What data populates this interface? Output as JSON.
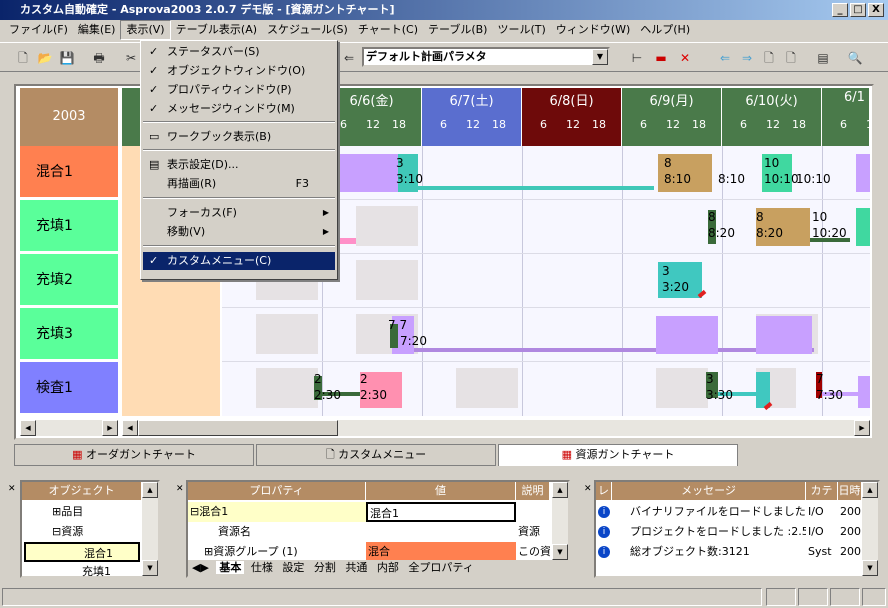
{
  "window": {
    "title": "カスタム自動確定 - Asprova2003 2.0.7 デモ版 - [資源ガントチャート]",
    "min": "_",
    "max": "□",
    "close": "X"
  },
  "menu": [
    "ファイル(F)",
    "編集(E)",
    "表示(V)",
    "テーブル表示(A)",
    "スケジュール(S)",
    "チャート(C)",
    "テーブル(B)",
    "ツール(T)",
    "ウィンドウ(W)",
    "ヘルプ(H)"
  ],
  "toolbar": {
    "param_combo": "デフォルト計画パラメタ"
  },
  "view_menu": {
    "items": [
      {
        "label": "ステータスバー(S)",
        "checked": "✓"
      },
      {
        "label": "オブジェクトウィンドウ(O)",
        "checked": "✓"
      },
      {
        "label": "プロパティウィンドウ(P)",
        "checked": "✓"
      },
      {
        "label": "メッセージウィンドウ(M)",
        "checked": "✓"
      },
      {
        "label": "ワークブック表示(B)"
      },
      {
        "label": "表示設定(D)..."
      },
      {
        "label": "再描画(R)",
        "shortcut": "F3"
      },
      {
        "label": "フォーカス(F)",
        "submenu": "▶"
      },
      {
        "label": "移動(V)",
        "submenu": "▶"
      },
      {
        "label": "カスタムメニュー(C)",
        "checked": "✓"
      }
    ]
  },
  "gantt": {
    "year": "2003",
    "days": [
      {
        "label": "6/6(金)",
        "color": "#4a7a4a"
      },
      {
        "label": "6/7(土)",
        "color": "#5a6ecf"
      },
      {
        "label": "6/8(日)",
        "color": "#6e0a0a"
      },
      {
        "label": "6/9(月)",
        "color": "#4a7a4a"
      },
      {
        "label": "6/10(火)",
        "color": "#4a7a4a"
      },
      {
        "label": "6/1",
        "color": "#4a7a4a"
      }
    ],
    "ticks": [
      "6",
      "12",
      "18"
    ],
    "resources": [
      {
        "name": "混合1",
        "color": "#ff8050"
      },
      {
        "name": "充填1",
        "color": "#5aff9a"
      },
      {
        "name": "充填2",
        "color": "#5aff9a"
      },
      {
        "name": "充填3",
        "color": "#5aff9a"
      },
      {
        "name": "検査1",
        "color": "#8080ff"
      }
    ],
    "labels": {
      "r1a": "3",
      "r1b": "3:10",
      "r1c": "8",
      "r1d": "8:10",
      "r1e": "8:10",
      "r1f": "10",
      "r1g": "10:10",
      "r1h": "10:10",
      "r2a": "8",
      "r2b": "8:20",
      "r2c": "8",
      "r2d": "8:20",
      "r2e": "10",
      "r2f": "10:20",
      "r3a": "3",
      "r3b": "3:20",
      "r4a": "7 7",
      "r4b": "7:20",
      "r5a": "2",
      "r5b": "2:30",
      "r5c": "2",
      "r5d": "2:30",
      "r5e": "3",
      "r5f": "3:30",
      "r5g": "7",
      "r5h": "7:30"
    }
  },
  "tabs": [
    "オーダガントチャート",
    "カスタムメニュー",
    "資源ガントチャート"
  ],
  "object_panel": {
    "header": "オブジェクト",
    "items": [
      "⊞品目",
      "⊟資源",
      "混合1",
      "充填1"
    ]
  },
  "property_panel": {
    "headers": [
      "プロパティ",
      "値",
      "説明"
    ],
    "rows": [
      [
        "⊟混合1",
        "混合1",
        ""
      ],
      [
        "資源名",
        "",
        "資源"
      ],
      [
        "⊞資源グループ (1)",
        "混合",
        "この資"
      ]
    ],
    "tabs": [
      "基本",
      "仕様",
      "設定",
      "分割",
      "共通",
      "内部",
      "全プロパティ"
    ]
  },
  "message_panel": {
    "headers": [
      "レ",
      "メッセージ",
      "カテ",
      "日時"
    ],
    "rows": [
      [
        "i",
        "バイナリファイルをロードしました",
        "I/O",
        "200"
      ],
      [
        "i",
        "プロジェクトをロードしました :2.5",
        "I/O",
        "200"
      ],
      [
        "i",
        "総オブジェクト数:3121",
        "Syst",
        "200"
      ]
    ]
  }
}
